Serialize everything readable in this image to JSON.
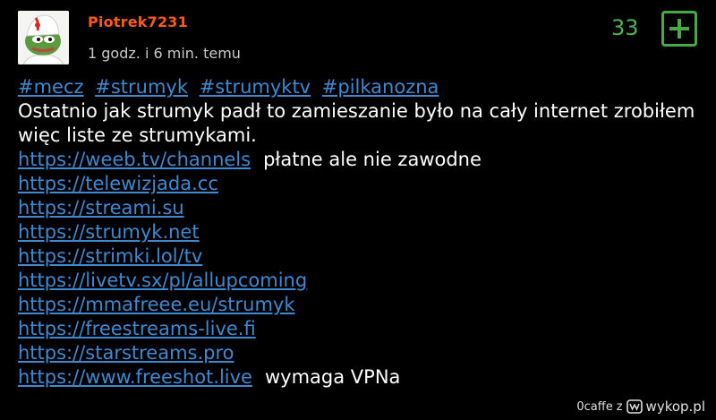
{
  "post": {
    "author": "Piotrek7231",
    "time": "1 godz. i 6 min. temu",
    "votes": "33",
    "tags": [
      "#mecz",
      "#strumyk",
      "#strumyktv",
      "#pilkanozna"
    ],
    "text": "Ostatnio jak strumyk padł to zamieszanie było na cały internet zrobiłem więc liste ze strumykami.",
    "links": [
      {
        "url": "https://weeb.tv/channels",
        "note": "płatne ale nie zawodne"
      },
      {
        "url": "https://telewizjada.cc",
        "note": ""
      },
      {
        "url": "https://streami.su",
        "note": ""
      },
      {
        "url": "https://strumyk.net",
        "note": ""
      },
      {
        "url": "https://strimki.lol/tv",
        "note": ""
      },
      {
        "url": "https://livetv.sx/pl/allupcoming",
        "note": ""
      },
      {
        "url": "https://mmafreee.eu/strumyk",
        "note": ""
      },
      {
        "url": "https://freestreams-live.fi",
        "note": ""
      },
      {
        "url": "https://starstreams.pro",
        "note": ""
      },
      {
        "url": "https://www.freeshot.live",
        "note": "wymaga VPNa"
      }
    ]
  },
  "footer": {
    "user": "0caffe",
    "separator": "z",
    "site": "wykop.pl"
  },
  "icons": {
    "avatar": "pepe-frog-avatar",
    "plus": "plus-icon",
    "logo": "wykop-logo-icon"
  },
  "colors": {
    "author": "#ff5917",
    "link": "#3d8ad1",
    "votes": "#4fb14f",
    "background": "#000000"
  }
}
